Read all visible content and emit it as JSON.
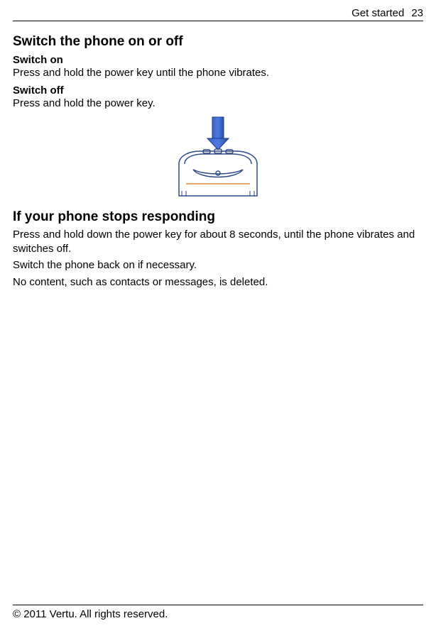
{
  "header": {
    "section": "Get started",
    "page": "23"
  },
  "section1": {
    "title": "Switch the phone on or off",
    "sub_on_title": "Switch on",
    "sub_on_text": "Press and hold the power key until the phone vibrates.",
    "sub_off_title": "Switch off",
    "sub_off_text": "Press and hold the power key."
  },
  "section2": {
    "title": "If your phone stops responding",
    "p1": "Press and hold down the power key for about 8 seconds, until the phone vibrates and switches off.",
    "p2": "Switch the phone back on if necessary.",
    "p3": "No content, such as contacts or messages, is deleted."
  },
  "footer": {
    "copyright": "© 2011 Vertu. All rights reserved."
  },
  "illustration": {
    "alt": "phone-top-power-key-with-arrow"
  }
}
